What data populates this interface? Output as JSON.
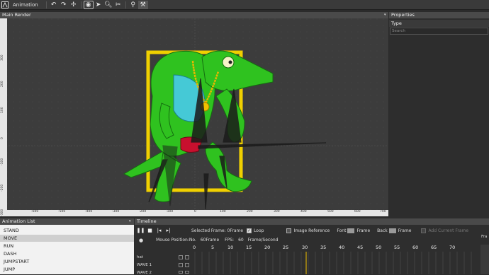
{
  "toolbar": {
    "mode_label": "Animation"
  },
  "main_render": {
    "title": "Main Render",
    "ruler_x": [
      "-600",
      "-500",
      "-400",
      "-300",
      "-200",
      "-100",
      "0",
      "100",
      "200",
      "300",
      "400",
      "500",
      "600",
      "700"
    ],
    "ruler_y": [
      "300",
      "200",
      "100",
      "0",
      "-100",
      "-200",
      "-300"
    ]
  },
  "properties": {
    "title": "Properties",
    "type_label": "Type",
    "search_placeholder": "Search"
  },
  "animation_list": {
    "title": "Animation List",
    "items": [
      {
        "label": "STAND",
        "selected": false
      },
      {
        "label": "MOVE",
        "selected": true
      },
      {
        "label": "RUN",
        "selected": false
      },
      {
        "label": "DASH",
        "selected": false
      },
      {
        "label": "JUMPSTART",
        "selected": false
      },
      {
        "label": "JUMP",
        "selected": false
      }
    ]
  },
  "timeline": {
    "title": "Timeline",
    "selected_frame": "Selected Frame: 0Frame",
    "loop_label": "Loop",
    "image_reference_label": "Image Reference",
    "font_label": "Font",
    "frame_label_1": "Frame",
    "back_label": "Back",
    "frame_label_2": "Frame",
    "add_current_frame": "Add Current Frame",
    "mouse_position": "Mouse Position:No.",
    "total_frames": "60Frame",
    "fps_label": "FPS:",
    "fps_value": "60",
    "fps_unit": "Frame/Second",
    "ticks": [
      "0",
      "5",
      "10",
      "15",
      "20",
      "25",
      "30",
      "35",
      "40",
      "45",
      "50",
      "55",
      "60",
      "65",
      "70"
    ],
    "tracks": [
      "hat",
      "WAVE 1",
      "WAVE 2"
    ],
    "right_label": "Fra"
  },
  "colors": {
    "accent_yellow": "#f0d000",
    "croc_green": "#2fc21f",
    "shirt_cyan": "#45c9d6",
    "playhead": "#f0c000"
  }
}
